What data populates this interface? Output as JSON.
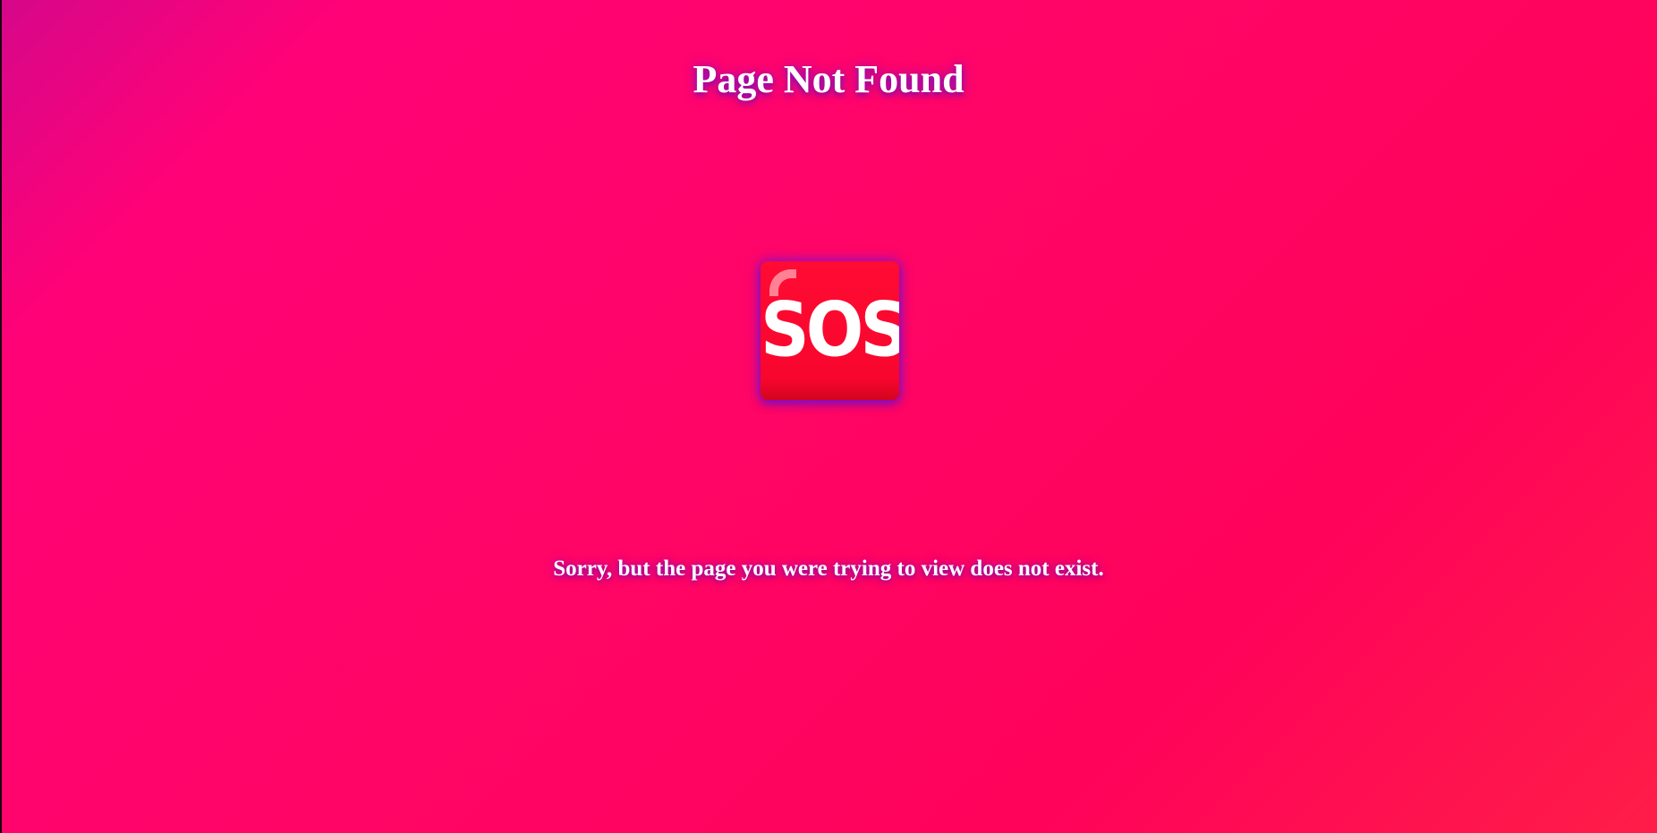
{
  "page": {
    "title": "Page Not Found",
    "message": "Sorry, but the page you were trying to view does not exist."
  },
  "icon": {
    "name": "sos-icon",
    "label": "SOS",
    "color": "#ff0b33"
  },
  "colors": {
    "background_start": "#d6078a",
    "background_mid": "#ff0566",
    "background_end": "#ff1d48",
    "text": "#ffffff",
    "glow": "#7814d2"
  }
}
